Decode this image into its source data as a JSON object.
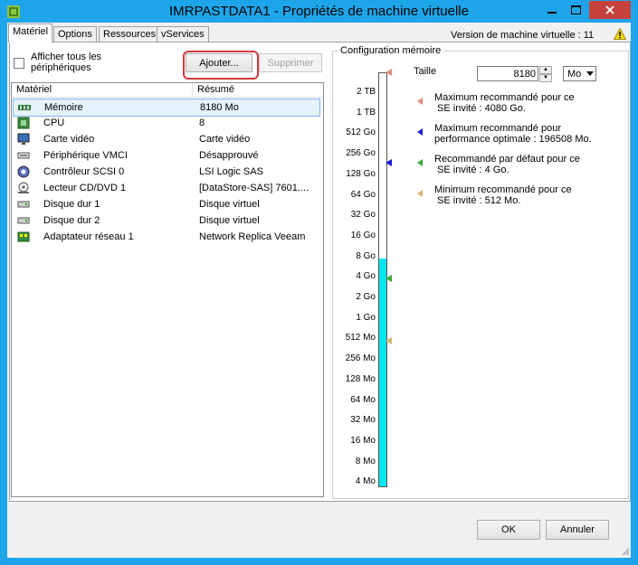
{
  "window": {
    "title": "IMRPASTDATA1 - Propriétés de machine virtuelle"
  },
  "tabs": [
    "Matériel",
    "Options",
    "Ressources",
    "vServices"
  ],
  "version_label": "Version de machine virtuelle : 11",
  "show_all": {
    "label": "Afficher tous les périphériques",
    "checked": false
  },
  "buttons": {
    "add": "Ajouter...",
    "remove": "Supprimer",
    "ok": "OK",
    "cancel": "Annuler"
  },
  "table": {
    "headers": [
      "Matériel",
      "Résumé"
    ],
    "rows": [
      {
        "name": "Mémoire",
        "summary": "8180 Mo",
        "icon": "memory-icon",
        "selected": true
      },
      {
        "name": "CPU",
        "summary": "8",
        "icon": "cpu-icon"
      },
      {
        "name": "Carte vidéo",
        "summary": "Carte vidéo",
        "icon": "monitor-icon"
      },
      {
        "name": "Périphérique VMCI",
        "summary": "Désapprouvé",
        "icon": "vmci-device-icon"
      },
      {
        "name": "Contrôleur SCSI 0",
        "summary": "LSI Logic SAS",
        "icon": "scsi-controller-icon"
      },
      {
        "name": "Lecteur CD/DVD 1",
        "summary": "[DataStore-SAS] 7601....",
        "icon": "cd-dvd-icon"
      },
      {
        "name": "Disque dur 1",
        "summary": "Disque virtuel",
        "icon": "hard-disk-icon"
      },
      {
        "name": "Disque dur 2",
        "summary": "Disque virtuel",
        "icon": "hard-disk-icon"
      },
      {
        "name": "Adaptateur réseau 1",
        "summary": "Network Replica Veeam",
        "icon": "network-adapter-icon"
      }
    ]
  },
  "memory": {
    "group_title": "Configuration mémoire",
    "size_label": "Taille",
    "size_value": "8180",
    "unit": "Mo",
    "scale_labels": [
      "2 TB",
      "1 TB",
      "512 Go",
      "256 Go",
      "128 Go",
      "64 Go",
      "32 Go",
      "16 Go",
      "8 Go",
      "4 Go",
      "2 Go",
      "1 Go",
      "512 Mo",
      "256 Mo",
      "128 Mo",
      "64 Mo",
      "32 Mo",
      "16 Mo",
      "8 Mo",
      "4 Mo"
    ],
    "fill_level_label": "8 Go",
    "markers": [
      {
        "label": "Maximum recommandé pour ce\n SE invité : 4080 Go.",
        "at": "4 TB",
        "color": "#e38a7a"
      },
      {
        "label": "Maximum recommandé pour\nperformance optimale : 196508 Mo.",
        "at": "192 Go",
        "color": "#1a1acc"
      },
      {
        "label": "Recommandé par défaut pour ce\n SE invité : 4 Go.",
        "at": "4 Go",
        "color": "#3aaa3a"
      },
      {
        "label": "Minimum recommandé pour ce\n SE invité : 512 Mo.",
        "at": "512 Mo",
        "color": "#d6b47a"
      }
    ]
  }
}
